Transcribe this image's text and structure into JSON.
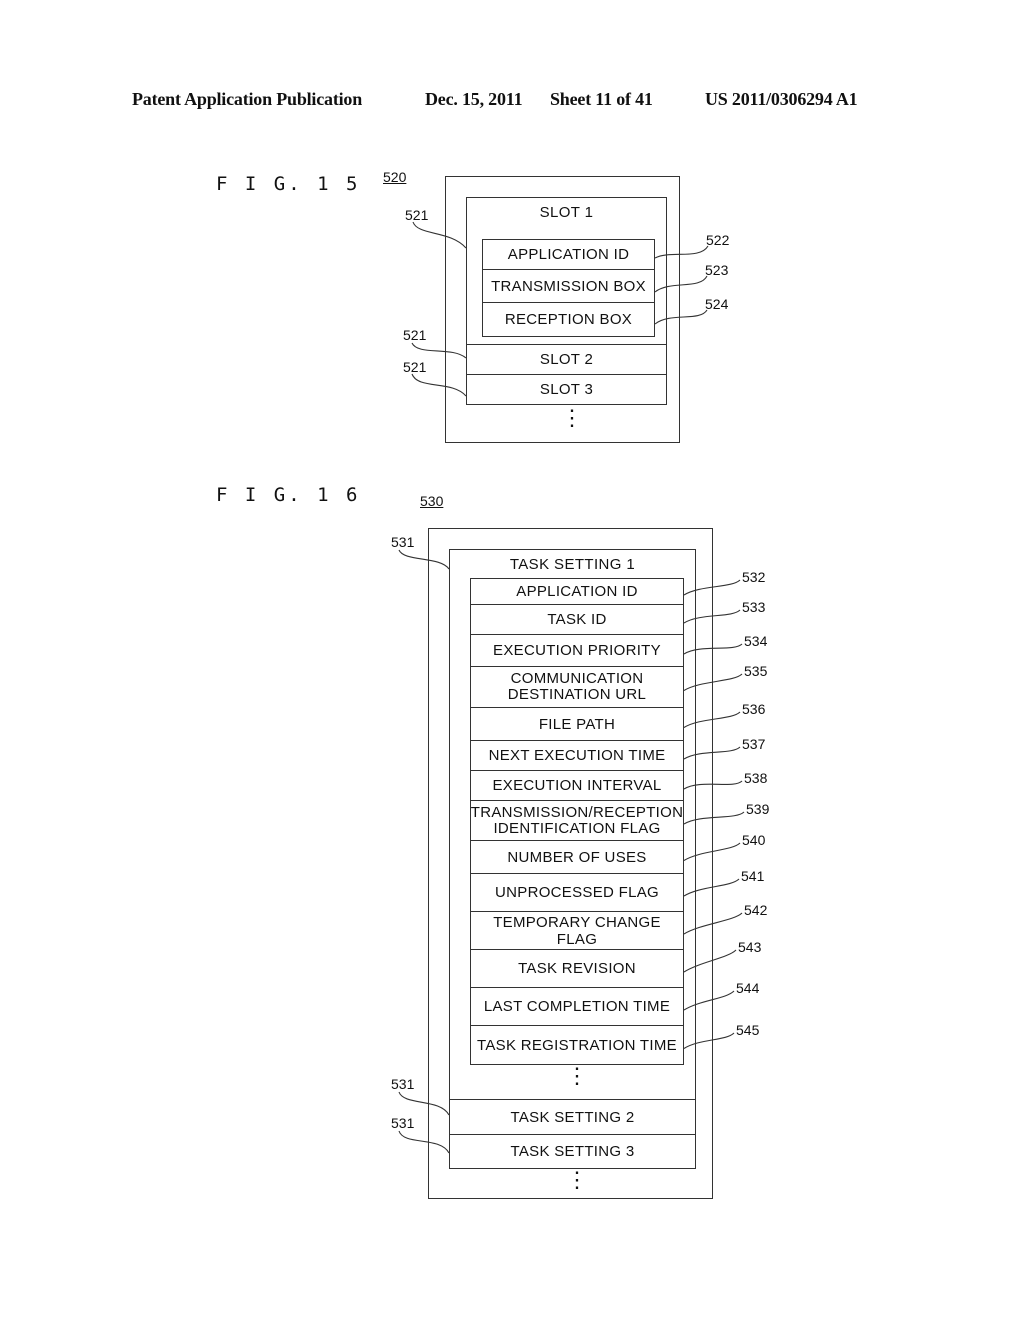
{
  "header": {
    "publication": "Patent Application Publication",
    "date": "Dec. 15, 2011",
    "sheet": "Sheet 11 of 41",
    "number": "US 2011/0306294 A1"
  },
  "fig15": {
    "label": "F I G. 1 5",
    "ref_main": "520",
    "slot1_title": "SLOT 1",
    "fields": [
      {
        "text": "APPLICATION ID",
        "ref": "522"
      },
      {
        "text": "TRANSMISSION BOX",
        "ref": "523"
      },
      {
        "text": "RECEPTION BOX",
        "ref": "524"
      }
    ],
    "slot2": "SLOT 2",
    "slot3": "SLOT 3",
    "slot_ref": "521",
    "ellipsis": "⋮"
  },
  "fig16": {
    "label": "F I G. 1 6",
    "ref_main": "530",
    "setting1_title": "TASK SETTING 1",
    "fields": [
      {
        "text": "APPLICATION ID",
        "ref": "532"
      },
      {
        "text": "TASK ID",
        "ref": "533"
      },
      {
        "text": "EXECUTION PRIORITY",
        "ref": "534"
      },
      {
        "text": "COMMUNICATION\nDESTINATION URL",
        "ref": "535"
      },
      {
        "text": "FILE PATH",
        "ref": "536"
      },
      {
        "text": "NEXT EXECUTION TIME",
        "ref": "537"
      },
      {
        "text": "EXECUTION INTERVAL",
        "ref": "538"
      },
      {
        "text": "TRANSMISSION/RECEPTION\nIDENTIFICATION FLAG",
        "ref": "539"
      },
      {
        "text": "NUMBER OF USES",
        "ref": "540"
      },
      {
        "text": "UNPROCESSED FLAG",
        "ref": "541"
      },
      {
        "text": "TEMPORARY CHANGE FLAG",
        "ref": "542"
      },
      {
        "text": "TASK REVISION",
        "ref": "543"
      },
      {
        "text": "LAST COMPLETION TIME",
        "ref": "544"
      },
      {
        "text": "TASK REGISTRATION TIME",
        "ref": "545"
      }
    ],
    "setting2": "TASK SETTING 2",
    "setting3": "TASK SETTING 3",
    "setting_ref": "531",
    "ellipsis": "⋮"
  }
}
